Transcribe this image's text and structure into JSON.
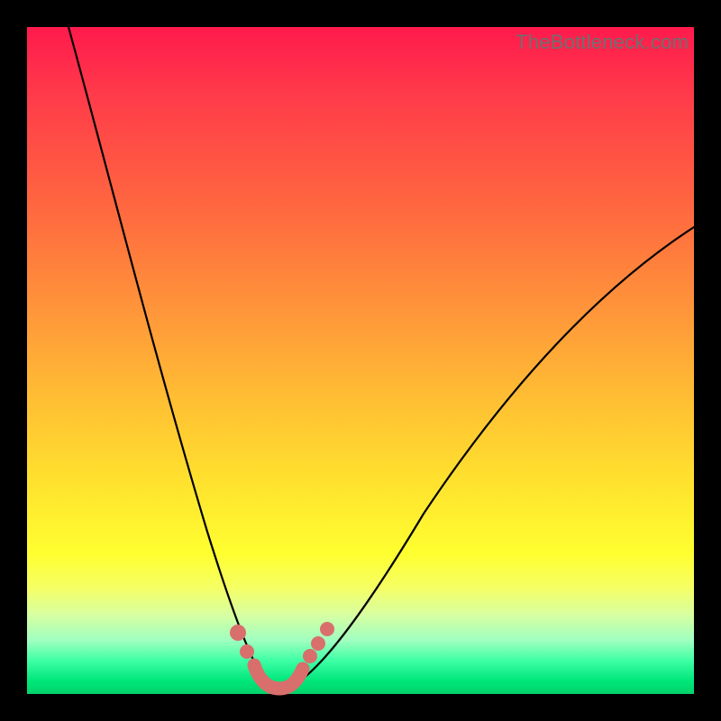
{
  "watermark": {
    "text": "TheBottleneck.com"
  },
  "chart_data": {
    "type": "line",
    "title": "",
    "xlabel": "",
    "ylabel": "",
    "xlim": [
      0,
      100
    ],
    "ylim": [
      0,
      100
    ],
    "grid": false,
    "legend": false,
    "series": [
      {
        "name": "bottleneck-curve",
        "x": [
          6,
          10,
          14,
          18,
          22,
          26,
          29,
          31,
          33,
          35,
          37,
          39,
          42,
          46,
          52,
          60,
          70,
          82,
          96,
          100
        ],
        "y": [
          100,
          88,
          76,
          64,
          52,
          38,
          26,
          18,
          10,
          4,
          1,
          2,
          6,
          14,
          26,
          40,
          54,
          66,
          76,
          78
        ]
      }
    ],
    "highlight": {
      "name": "sweet-spot-band",
      "x": [
        31,
        33,
        35,
        37,
        39,
        41,
        43
      ],
      "y": [
        11,
        5,
        2,
        1,
        2,
        5,
        10
      ]
    },
    "background_gradient": {
      "top": "#ff1a4d",
      "mid": "#ffe12e",
      "bottom": "#00d36a"
    }
  }
}
